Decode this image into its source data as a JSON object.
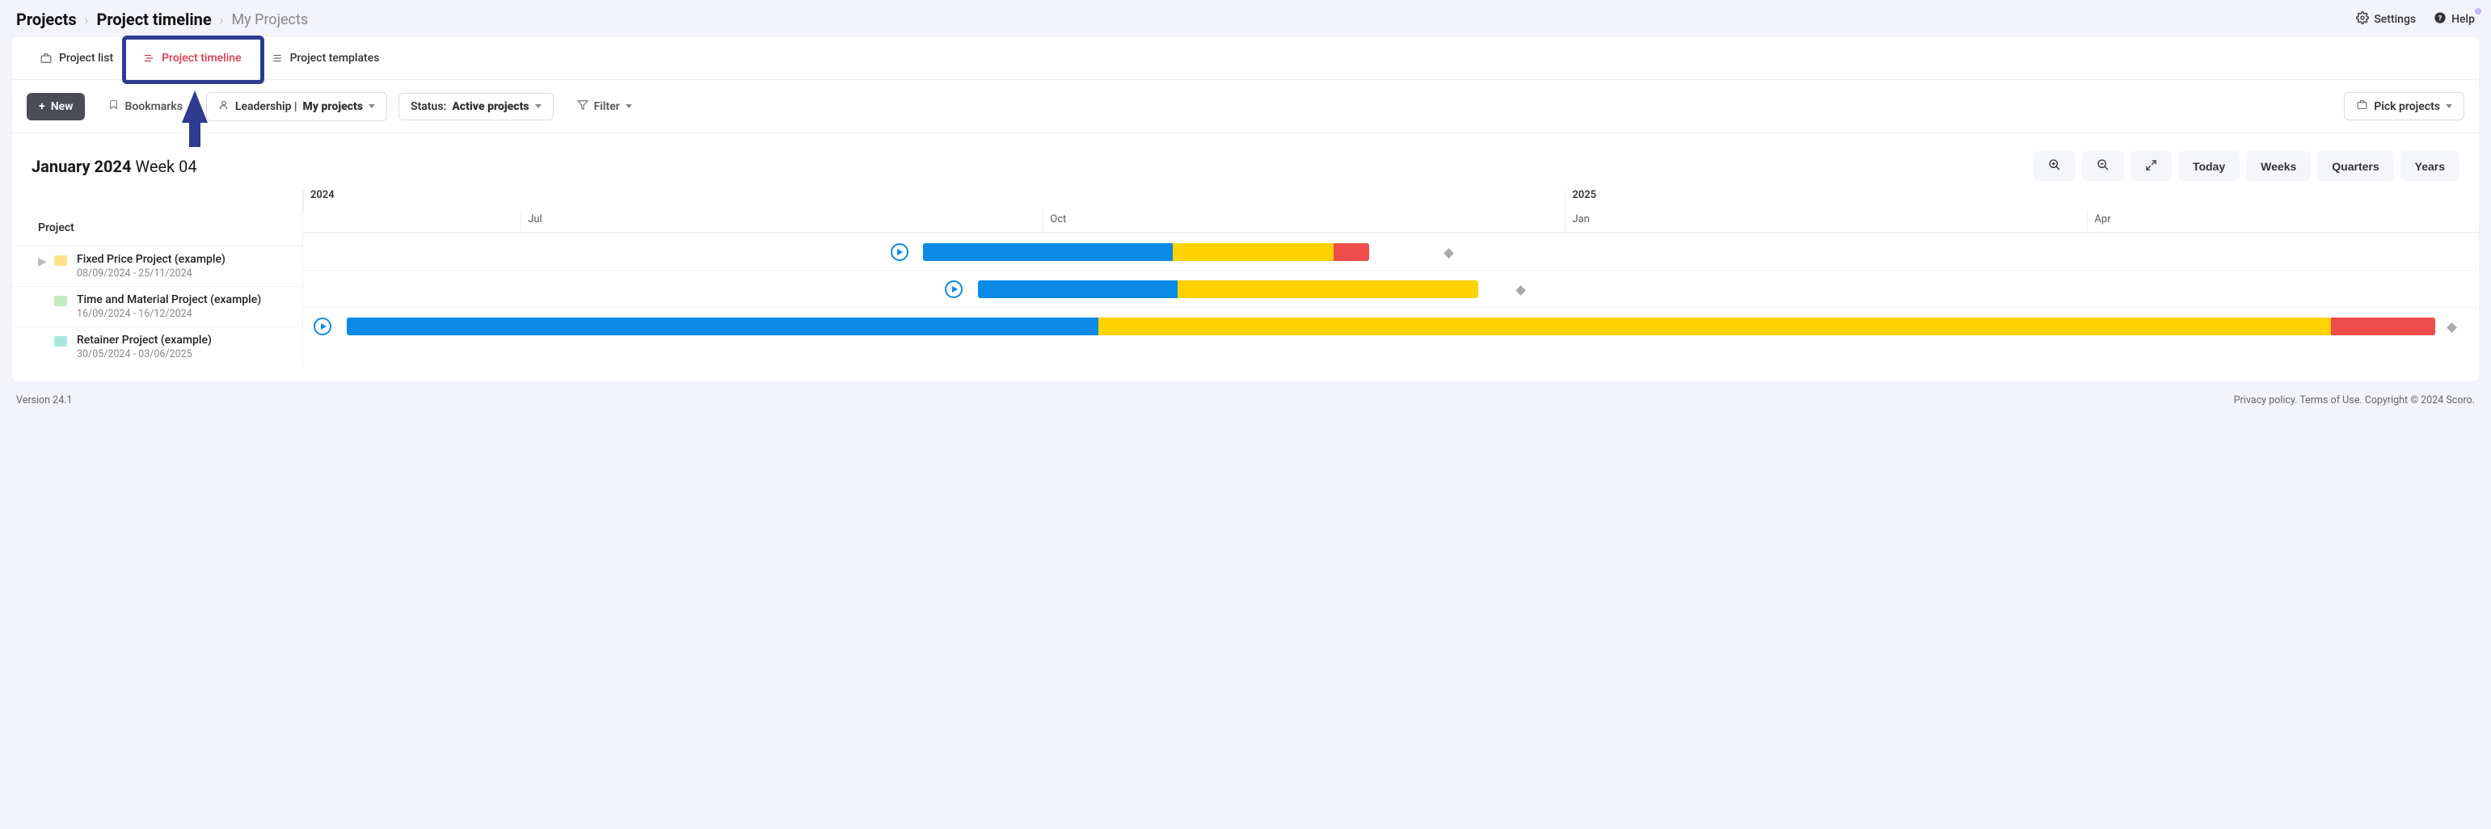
{
  "breadcrumb": {
    "root": "Projects",
    "section": "Project timeline",
    "page": "My Projects"
  },
  "top_links": {
    "settings": "Settings",
    "help": "Help"
  },
  "tabs": {
    "list": "Project list",
    "timeline": "Project timeline",
    "templates": "Project templates"
  },
  "toolbar": {
    "new": "New",
    "bookmarks": "Bookmarks",
    "scope_prefix": "Leadership | ",
    "scope_value": "My projects",
    "status_prefix": "Status: ",
    "status_value": "Active projects",
    "filter": "Filter",
    "pick_projects": "Pick projects"
  },
  "timeline": {
    "month_year": "January 2024",
    "week": "Week 04",
    "controls": {
      "today": "Today",
      "weeks": "Weeks",
      "quarters": "Quarters",
      "years": "Years"
    },
    "columns_header": "Project",
    "years": [
      "2024",
      "2025"
    ],
    "months": [
      "Jul",
      "Oct",
      "Jan",
      "Apr"
    ],
    "projects": [
      {
        "name": "Fixed Price Project (example)",
        "dates": "08/09/2024 - 25/11/2024",
        "color": "yellow",
        "expandable": true
      },
      {
        "name": "Time and Material Project (example)",
        "dates": "16/09/2024 - 16/12/2024",
        "color": "green",
        "expandable": false
      },
      {
        "name": "Retainer Project (example)",
        "dates": "30/05/2024 - 03/06/2025",
        "color": "teal",
        "expandable": false
      }
    ]
  },
  "footer": {
    "version": "Version 24.1",
    "privacy": "Privacy policy.",
    "terms": "Terms of Use.",
    "copyright": "Copyright © 2024 Scoro."
  }
}
